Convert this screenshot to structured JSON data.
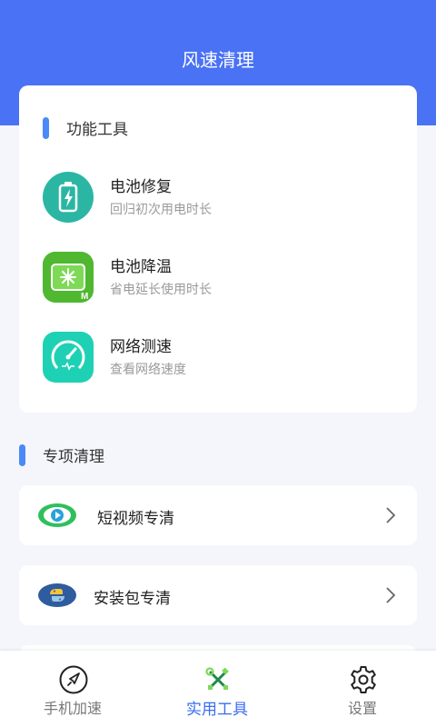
{
  "header": {
    "title": "风速清理"
  },
  "tools_section": {
    "title": "功能工具",
    "items": [
      {
        "name": "电池修复",
        "desc": "回归初次用电时长",
        "icon": "battery-repair-icon"
      },
      {
        "name": "电池降温",
        "desc": "省电延长使用时长",
        "icon": "battery-cool-icon"
      },
      {
        "name": "网络测速",
        "desc": "查看网络速度",
        "icon": "speedometer-icon"
      }
    ]
  },
  "special_section": {
    "title": "专项清理",
    "items": [
      {
        "label": "短视频专清",
        "icon": "short-video-icon"
      },
      {
        "label": "安装包专清",
        "icon": "package-icon"
      }
    ]
  },
  "bottom_nav": {
    "items": [
      {
        "label": "手机加速",
        "icon": "rocket-icon",
        "active": false
      },
      {
        "label": "实用工具",
        "icon": "tools-icon",
        "active": true
      },
      {
        "label": "设置",
        "icon": "gear-icon",
        "active": false
      }
    ]
  },
  "colors": {
    "accent": "#4a72f5",
    "active_nav": "#3a6df0",
    "section_bar": "#4a8af7"
  }
}
